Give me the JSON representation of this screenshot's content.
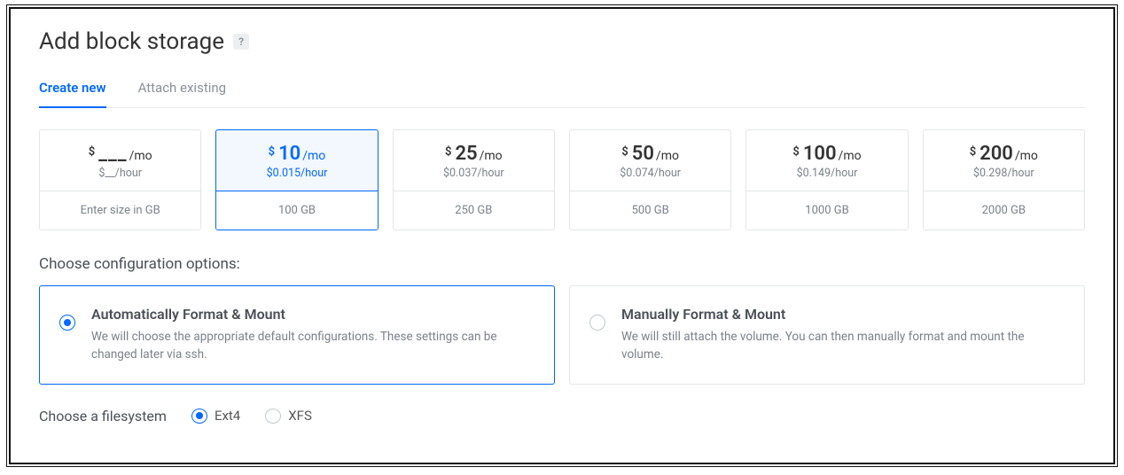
{
  "title": "Add block storage",
  "help_glyph": "?",
  "tabs": [
    {
      "label": "Create new",
      "active": true
    },
    {
      "label": "Attach existing",
      "active": false
    }
  ],
  "custom_plan": {
    "price_mo_placeholder": "___",
    "price_hour_placeholder": "__",
    "size_placeholder": "Enter size in GB"
  },
  "plans": [
    {
      "price": "10",
      "per_hour": "$0.015/hour",
      "size": "100 GB",
      "selected": true
    },
    {
      "price": "25",
      "per_hour": "$0.037/hour",
      "size": "250 GB",
      "selected": false
    },
    {
      "price": "50",
      "per_hour": "$0.074/hour",
      "size": "500 GB",
      "selected": false
    },
    {
      "price": "100",
      "per_hour": "$0.149/hour",
      "size": "1000 GB",
      "selected": false
    },
    {
      "price": "200",
      "per_hour": "$0.298/hour",
      "size": "2000 GB",
      "selected": false
    }
  ],
  "labels": {
    "per_mo": "/mo",
    "per_hour_suffix": "/hour",
    "dollar": "$"
  },
  "config_section_label": "Choose configuration options:",
  "config_options": [
    {
      "title": "Automatically Format & Mount",
      "desc": "We will choose the appropriate default configurations. These settings can be changed later via ssh.",
      "selected": true
    },
    {
      "title": "Manually Format & Mount",
      "desc": "We will still attach the volume. You can then manually format and mount the volume.",
      "selected": false
    }
  ],
  "fs_label": "Choose a filesystem",
  "filesystems": [
    {
      "label": "Ext4",
      "selected": true
    },
    {
      "label": "XFS",
      "selected": false
    }
  ]
}
